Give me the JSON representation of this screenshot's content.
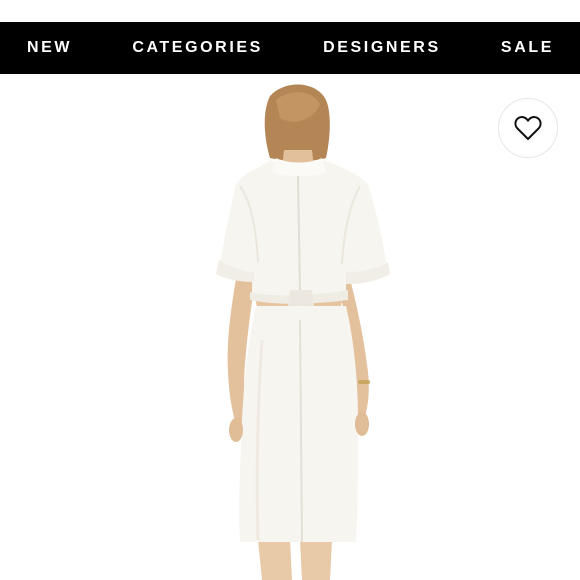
{
  "nav": {
    "items": [
      {
        "label": "NEW"
      },
      {
        "label": "CATEGORIES"
      },
      {
        "label": "DESIGNERS"
      },
      {
        "label": "SALE"
      }
    ]
  },
  "product": {
    "image": "white short-sleeve shirt dress with cutout back, back view on model",
    "favorite_icon": "heart-outline-icon"
  },
  "colors": {
    "nav_background": "#000000",
    "nav_text": "#ffffff",
    "page_background": "#ffffff",
    "dress": "#f7f5f0"
  }
}
